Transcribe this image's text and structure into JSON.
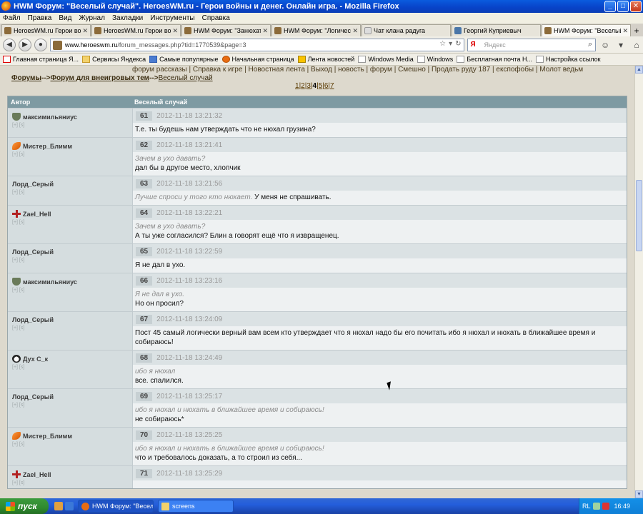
{
  "window": {
    "title": "HWM Форум: \"Веселый случай\". HeroesWM.ru - Герои войны и денег. Онлайн игра. - Mozilla Firefox"
  },
  "menu": [
    "Файл",
    "Правка",
    "Вид",
    "Журнал",
    "Закладки",
    "Инструменты",
    "Справка"
  ],
  "tabs": [
    {
      "label": "HeroesWM.ru Герои войн..."
    },
    {
      "label": "HeroesWM.ru Герои войн..."
    },
    {
      "label": "HWM Форум: \"Занюхать\"..."
    },
    {
      "label": "HWM Форум: \"Логическо..."
    },
    {
      "label": "Чат клана радуга"
    },
    {
      "label": "Георгий Куприевыч"
    },
    {
      "label": "HWM Форум: \"Веселый с..."
    }
  ],
  "urlbar": {
    "domain": "www.heroeswm.ru",
    "path": "/forum_messages.php?tid=1770539&page=3"
  },
  "search": {
    "placeholder": "Яндекс"
  },
  "bookmarks": [
    "Главная страница Я...",
    "Сервисы Яндекса",
    "Самые популярные",
    "Начальная страница",
    "Лента новостей",
    "Windows Media",
    "Windows",
    "Бесплатная почта H...",
    "Настройка ссылок"
  ],
  "topnav": "форум рассказы | Справка к игре | Новостная лента | Выход | новость | форум | Смешно | Продать руду 187 | експофобы | Молот ведьм",
  "breadcrumb": {
    "forums": "Форумы",
    "sep1": "-->",
    "section": "Форум для внеигровых тем",
    "sep2": "-->",
    "topic": "Веселый случай"
  },
  "pages": [
    "1",
    "2",
    "3",
    "4",
    "5",
    "6",
    "7"
  ],
  "current_page": "4",
  "table": {
    "col_author": "Автор",
    "col_title": "Веселый случай"
  },
  "posts": [
    {
      "author": "максимильяниус",
      "clan": "shield",
      "actions": "[+] [s]",
      "num": "61",
      "date": "2012-11-18 13:21:32",
      "quote": "",
      "text": "Т.е. ты будешь нам утверждать что не нюхал грузина?"
    },
    {
      "author": "Мистер_Блимм",
      "clan": "feather",
      "actions": "[+] [s]",
      "num": "62",
      "date": "2012-11-18 13:21:41",
      "quote": "Зачем в ухо давать?",
      "text": "дал бы в другое место, хлопчик"
    },
    {
      "author": "Лорд_Серый",
      "clan": "",
      "actions": "[+] [s]",
      "num": "63",
      "date": "2012-11-18 13:21:56",
      "quote": "Лучше спроси у того кто нюхает.",
      "text": " У меня не спрашивать."
    },
    {
      "author": "Zael_Hell",
      "clan": "cross",
      "actions": "[+] [s]",
      "num": "64",
      "date": "2012-11-18 13:22:21",
      "quote": "Зачем в ухо давать?",
      "text": "А ты уже согласился? Блин а говорят ещё что я извращенец."
    },
    {
      "author": "Лорд_Серый",
      "clan": "",
      "actions": "[+] [s]",
      "num": "65",
      "date": "2012-11-18 13:22:59",
      "quote": "",
      "text": "Я не дал в ухо."
    },
    {
      "author": "максимильяниус",
      "clan": "shield",
      "actions": "[+] [s]",
      "num": "66",
      "date": "2012-11-18 13:23:16",
      "quote": "Я не дал в ухо.",
      "text": "Но он просил?"
    },
    {
      "author": "Лорд_Серый",
      "clan": "",
      "actions": "[+] [s]",
      "num": "67",
      "date": "2012-11-18 13:24:09",
      "quote": "",
      "text": "Пост 45 самый логически верный вам всем кто утверждает что я нюхал надо бы его почитать ибо я нюхал и нюхать в ближайшее время и собираюсь!"
    },
    {
      "author": "Дух С_к",
      "clan": "panda",
      "actions": "[+] [s]",
      "num": "68",
      "date": "2012-11-18 13:24:49",
      "quote": "ибо я нюхал",
      "text": "все. спалился."
    },
    {
      "author": "Лорд_Серый",
      "clan": "",
      "actions": "[+] [s]",
      "num": "69",
      "date": "2012-11-18 13:25:17",
      "quote": "ибо я нюхал и нюхать в ближайшее время и собираюсь!",
      "text": "не собираюсь*"
    },
    {
      "author": "Мистер_Блимм",
      "clan": "feather",
      "actions": "[+] [s]",
      "num": "70",
      "date": "2012-11-18 13:25:25",
      "quote": "ибо я нюхал и нюхать в ближайшее время и собираюсь!",
      "text": "что и требовалось доказать, а то строил из себя..."
    },
    {
      "author": "Zael_Hell",
      "clan": "cross",
      "actions": "[+] [s]",
      "num": "71",
      "date": "2012-11-18 13:25:29",
      "quote": "",
      "text": ""
    }
  ],
  "taskbar": {
    "start": "пуск",
    "tasks": [
      "HWM Форум: \"Весел...",
      "screens"
    ],
    "lang": "RL",
    "clock": "16:49"
  }
}
